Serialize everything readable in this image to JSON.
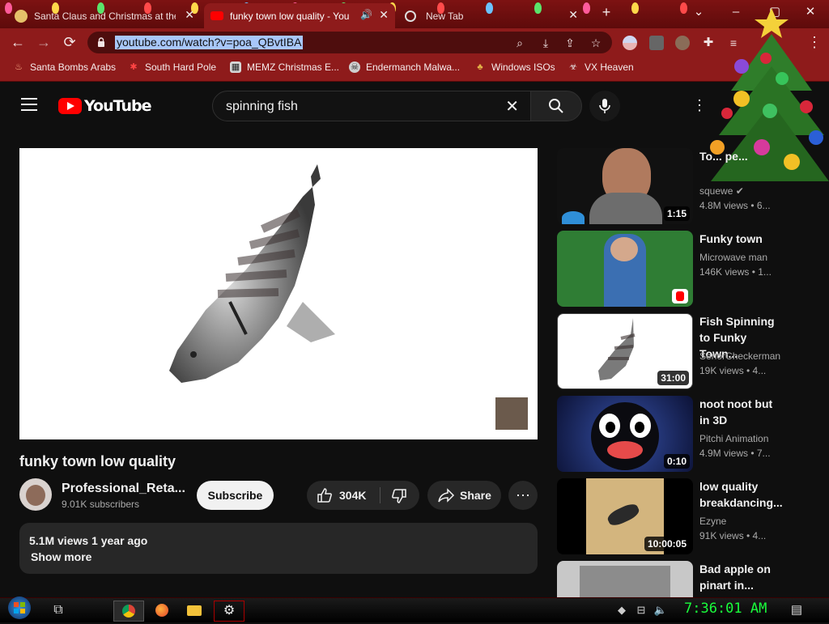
{
  "browser": {
    "tabs": [
      {
        "title": "Santa Claus and Christmas at the",
        "active": false
      },
      {
        "title": "funky town low quality - You",
        "active": true
      },
      {
        "title": "New Tab",
        "active": false
      }
    ],
    "new_tab_symbol": "+",
    "window_controls": {
      "minimize": "–",
      "maximize": "▢",
      "close": "✕",
      "tab_search": "⌄"
    },
    "url": "youtube.com/watch?v=poa_QBvtIBA",
    "nav": {
      "back": "←",
      "forward": "→",
      "reload": "⟳"
    },
    "bookmarks": [
      {
        "label": "Santa Bombs Arabs",
        "icon": "flame-icon"
      },
      {
        "label": "South Hard Pole",
        "icon": "snowflake-icon"
      },
      {
        "label": "MEMZ Christmas E...",
        "icon": "memz-icon"
      },
      {
        "label": "Endermanch Malwa...",
        "icon": "skull-icon"
      },
      {
        "label": "Windows ISOs",
        "icon": "tree-icon"
      },
      {
        "label": "VX Heaven",
        "icon": "biohazard-icon"
      }
    ],
    "toolbar_menu": "⋮"
  },
  "youtube": {
    "logo_text": "YouTube",
    "search_query": "spinning fish",
    "video_title": "funky town low quality",
    "channel_name": "Professional_Reta...",
    "subscribers": "9.01K subscribers",
    "subscribe_label": "Subscribe",
    "like_count": "304K",
    "share_label": "Share",
    "views_line": "5.1M views  1 year ago",
    "show_more": "Show more",
    "recommendations": [
      {
        "title": "To... pe...",
        "channel": "squewe ✔",
        "meta": "4.8M views  • 6...",
        "duration": "1:15"
      },
      {
        "title": "Funky town",
        "channel": "Microwave man",
        "meta": "146K views  • 1...",
        "duration": ""
      },
      {
        "title": "Fish Spinning to Funky Town...",
        "channel": "SenorCheckerman",
        "meta": "19K views  • 4...",
        "duration": "31:00"
      },
      {
        "title": "noot noot but in 3D",
        "channel": "Pitchi Animation",
        "meta": "4.9M views  • 7...",
        "duration": "0:10"
      },
      {
        "title": "low quality breakdancing...",
        "channel": "Ezyne",
        "meta": "91K views  • 4...",
        "duration": "10:00:05"
      },
      {
        "title": "Bad apple on pinart in...",
        "channel": "",
        "meta": "",
        "duration": ""
      }
    ]
  },
  "taskbar": {
    "clock": "7:36:01 AM"
  },
  "colors": {
    "chrome_red": "#8e1b1b",
    "tabstrip_red": "#6a0e0e",
    "yt_bg": "#0f0f0f",
    "yt_red": "#ff0000",
    "clock_green": "#19ff3c"
  }
}
